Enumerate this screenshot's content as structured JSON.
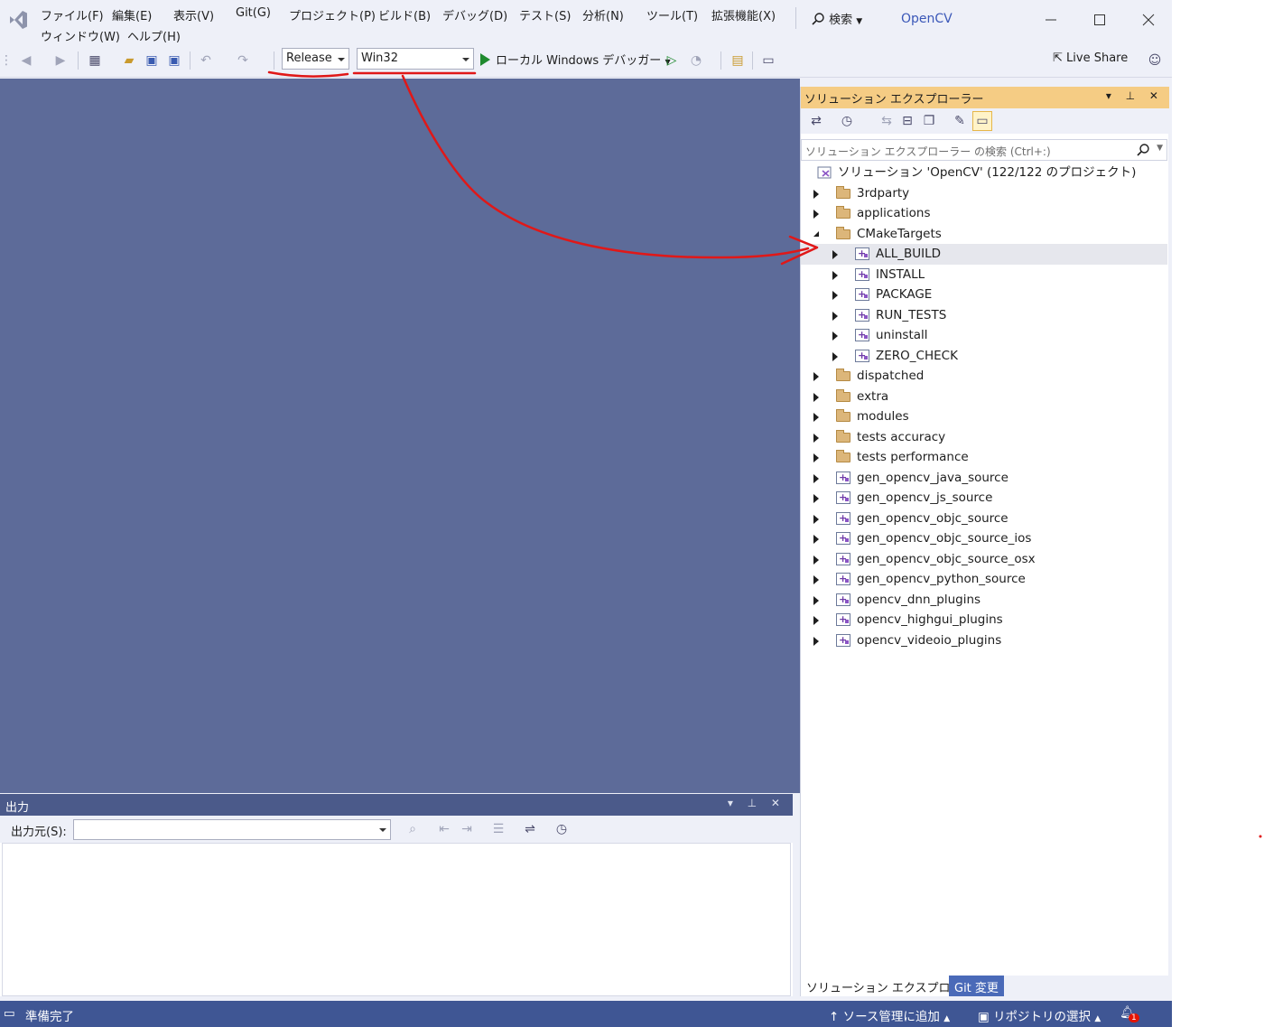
{
  "colors": {
    "accent": "#3f5694",
    "editor_bg": "#5d6b99",
    "panel_header_active": "#f5cc84",
    "annotation_red": "#e01818",
    "run_green": "#1f8a2e"
  },
  "menu": {
    "items": [
      "ファイル(F)",
      "編集(E)",
      "表示(V)",
      "Git(G)",
      "プロジェクト(P)",
      "ビルド(B)",
      "デバッグ(D)",
      "テスト(S)",
      "分析(N)",
      "ツール(T)",
      "拡張機能(X)"
    ],
    "row2": [
      "ウィンドウ(W)",
      "ヘルプ(H)"
    ],
    "search_label": "検索",
    "window_title": "OpenCV"
  },
  "toolbar": {
    "config_value": "Release",
    "platform_value": "Win32",
    "run_label": "ローカル Windows デバッガー",
    "live_share_label": "Live Share"
  },
  "solution_explorer": {
    "title": "ソリューション エクスプローラー",
    "search_placeholder": "ソリューション エクスプローラー の検索 (Ctrl+:)",
    "solution_label": "ソリューション 'OpenCV' (122/122 のプロジェクト)",
    "items": [
      {
        "label": "3rdparty",
        "kind": "folder",
        "level": 1,
        "expanded": false
      },
      {
        "label": "applications",
        "kind": "folder",
        "level": 1,
        "expanded": false
      },
      {
        "label": "CMakeTargets",
        "kind": "folder",
        "level": 1,
        "expanded": true
      },
      {
        "label": "ALL_BUILD",
        "kind": "project",
        "level": 2,
        "expanded": false,
        "selected": true
      },
      {
        "label": "INSTALL",
        "kind": "project",
        "level": 2,
        "expanded": false
      },
      {
        "label": "PACKAGE",
        "kind": "project",
        "level": 2,
        "expanded": false
      },
      {
        "label": "RUN_TESTS",
        "kind": "project",
        "level": 2,
        "expanded": false
      },
      {
        "label": "uninstall",
        "kind": "project",
        "level": 2,
        "expanded": false
      },
      {
        "label": "ZERO_CHECK",
        "kind": "project",
        "level": 2,
        "expanded": false
      },
      {
        "label": "dispatched",
        "kind": "folder",
        "level": 1,
        "expanded": false
      },
      {
        "label": "extra",
        "kind": "folder",
        "level": 1,
        "expanded": false
      },
      {
        "label": "modules",
        "kind": "folder",
        "level": 1,
        "expanded": false
      },
      {
        "label": "tests accuracy",
        "kind": "folder",
        "level": 1,
        "expanded": false
      },
      {
        "label": "tests performance",
        "kind": "folder",
        "level": 1,
        "expanded": false
      },
      {
        "label": "gen_opencv_java_source",
        "kind": "project",
        "level": 1,
        "expanded": false
      },
      {
        "label": "gen_opencv_js_source",
        "kind": "project",
        "level": 1,
        "expanded": false
      },
      {
        "label": "gen_opencv_objc_source",
        "kind": "project",
        "level": 1,
        "expanded": false
      },
      {
        "label": "gen_opencv_objc_source_ios",
        "kind": "project",
        "level": 1,
        "expanded": false
      },
      {
        "label": "gen_opencv_objc_source_osx",
        "kind": "project",
        "level": 1,
        "expanded": false
      },
      {
        "label": "gen_opencv_python_source",
        "kind": "project",
        "level": 1,
        "expanded": false
      },
      {
        "label": "opencv_dnn_plugins",
        "kind": "project",
        "level": 1,
        "expanded": false
      },
      {
        "label": "opencv_highgui_plugins",
        "kind": "project",
        "level": 1,
        "expanded": false
      },
      {
        "label": "opencv_videoio_plugins",
        "kind": "project",
        "level": 1,
        "expanded": false
      }
    ],
    "tabs": [
      "ソリューション エクスプローラー",
      "Git 変更"
    ]
  },
  "output": {
    "title": "出力",
    "source_label": "出力元(S):",
    "source_value": ""
  },
  "status": {
    "ready": "準備完了",
    "source_control": "ソース管理に追加",
    "repository": "リポジトリの選択",
    "notification_count": "1"
  }
}
